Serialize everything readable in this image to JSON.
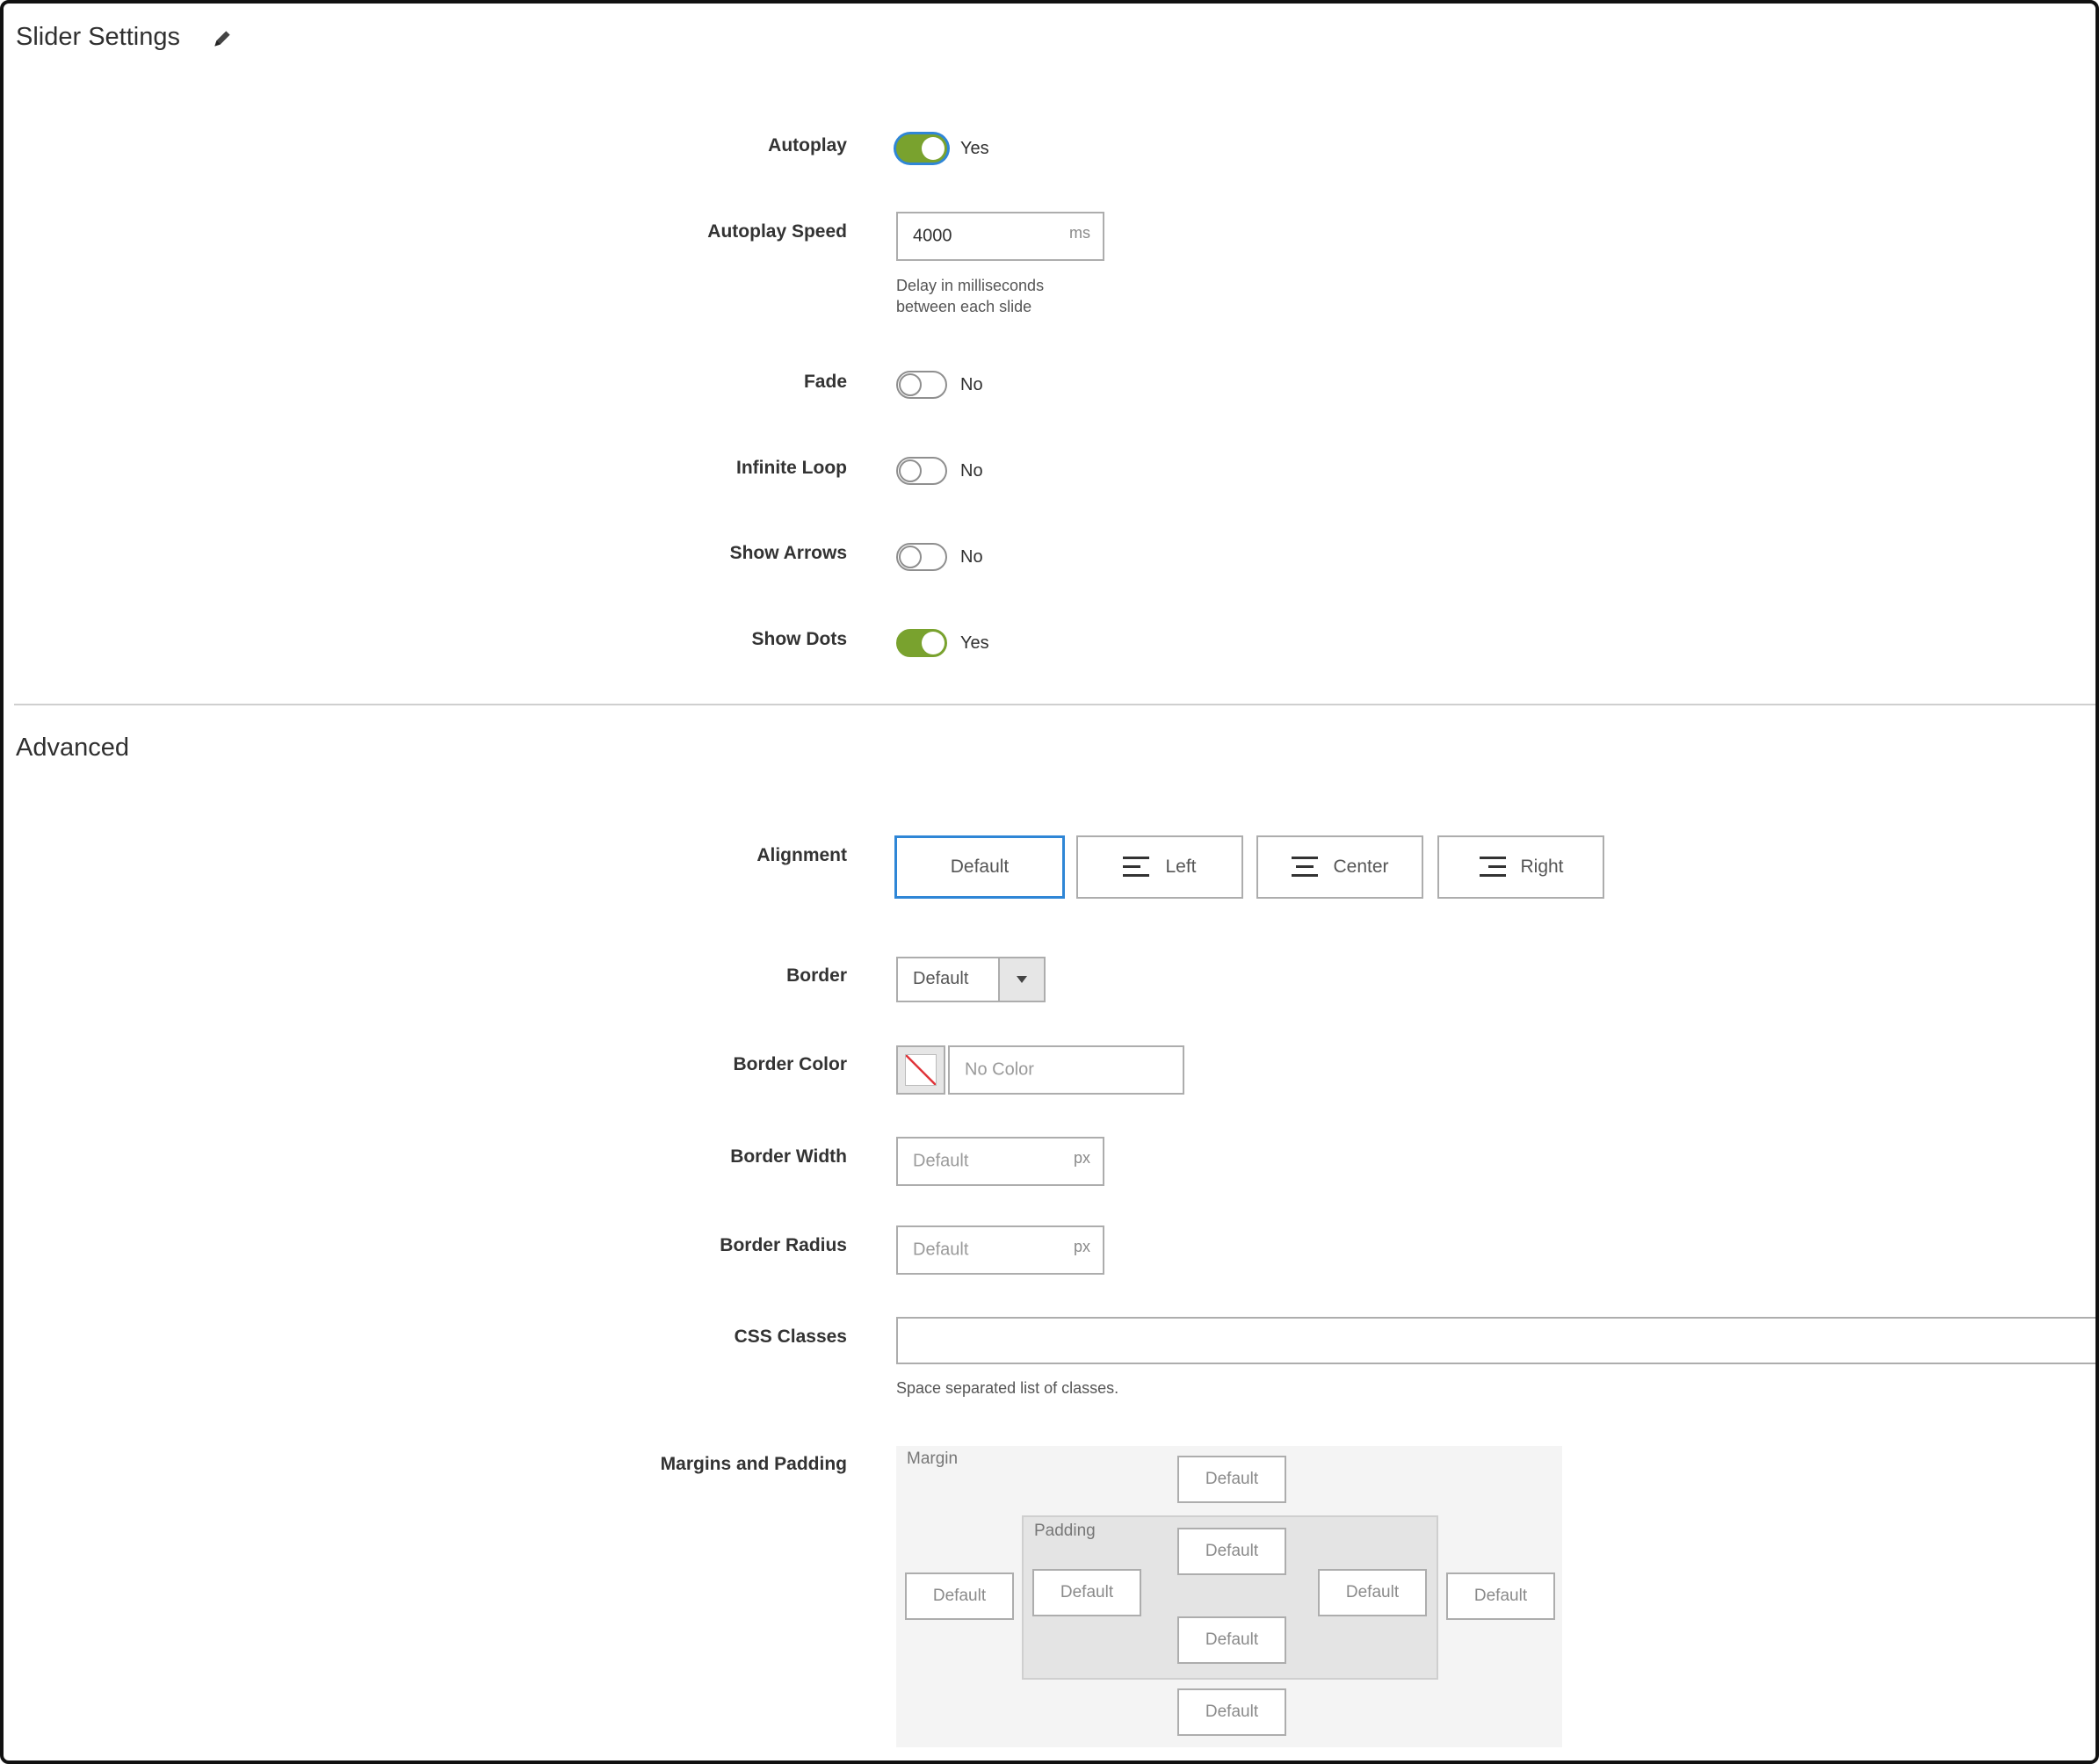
{
  "slider_settings": {
    "title": "Slider Settings",
    "edit_icon": "pencil-icon",
    "autoplay": {
      "label": "Autoplay",
      "state": true,
      "value_text": "Yes"
    },
    "autoplay_speed": {
      "label": "Autoplay Speed",
      "value": "4000",
      "unit": "ms",
      "note_line1": "Delay in milliseconds",
      "note_line2": "between each slide"
    },
    "fade": {
      "label": "Fade",
      "state": false,
      "value_text": "No"
    },
    "infinite_loop": {
      "label": "Infinite Loop",
      "state": false,
      "value_text": "No"
    },
    "show_arrows": {
      "label": "Show Arrows",
      "state": false,
      "value_text": "No"
    },
    "show_dots": {
      "label": "Show Dots",
      "state": true,
      "value_text": "Yes"
    }
  },
  "advanced": {
    "title": "Advanced",
    "alignment": {
      "label": "Alignment",
      "selected": "Default",
      "options": [
        {
          "label": "Default",
          "icon": ""
        },
        {
          "label": "Left",
          "icon": "align-left-icon"
        },
        {
          "label": "Center",
          "icon": "align-center-icon"
        },
        {
          "label": "Right",
          "icon": "align-right-icon"
        }
      ]
    },
    "border": {
      "label": "Border",
      "value": "Default"
    },
    "border_color": {
      "label": "Border Color",
      "placeholder": "No Color",
      "swatch_icon": "no-color-icon"
    },
    "border_width": {
      "label": "Border Width",
      "placeholder": "Default",
      "unit": "px"
    },
    "border_radius": {
      "label": "Border Radius",
      "placeholder": "Default",
      "unit": "px"
    },
    "css_classes": {
      "label": "CSS Classes",
      "value": "",
      "note": "Space separated list of classes."
    },
    "margins_padding": {
      "label": "Margins and Padding",
      "margin_label": "Margin",
      "padding_label": "Padding",
      "margin": {
        "top": "Default",
        "right": "Default",
        "bottom": "Default",
        "left": "Default"
      },
      "padding": {
        "top": "Default",
        "right": "Default",
        "bottom": "Default",
        "left": "Default"
      }
    }
  },
  "colors": {
    "toggle_on": "#79a22e",
    "focus": "#2f86d6",
    "border": "#adadad"
  }
}
